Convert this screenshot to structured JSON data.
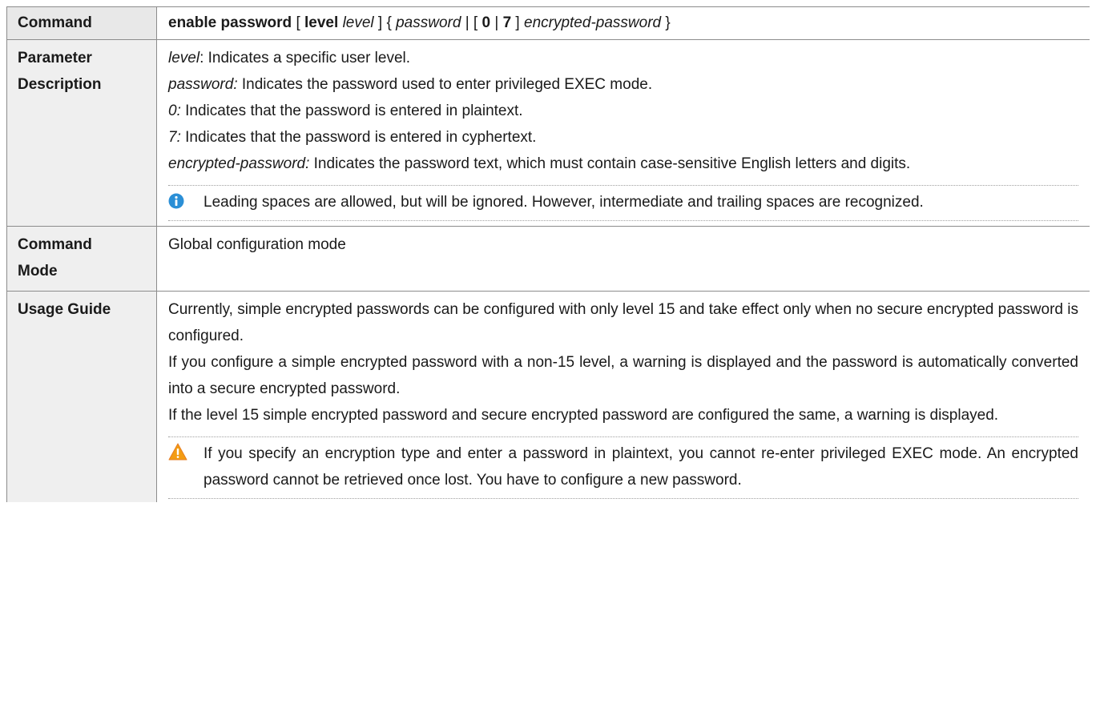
{
  "table": {
    "command": {
      "label": "Command",
      "syntax": {
        "kw1": "enable password",
        "s1": " [ ",
        "kw2": "level",
        "s2": " ",
        "arg1": "level",
        "s3": " ] { ",
        "arg2": "password",
        "s4": " | [ ",
        "kw3": "0",
        "s5": " | ",
        "kw4": "7",
        "s6": " ] ",
        "arg3": "encrypted-password",
        "s7": " }"
      }
    },
    "param": {
      "label_line1": "Parameter",
      "label_line2": "Description",
      "items": [
        {
          "term": "level",
          "sep": ":",
          "desc": " Indicates a specific user level."
        },
        {
          "term": "password:",
          "sep": "",
          "desc": " Indicates the password used to enter privileged EXEC mode."
        },
        {
          "term": "0:",
          "sep": "",
          "desc": " Indicates that the password is entered in plaintext."
        },
        {
          "term": "7:",
          "sep": "",
          "desc": " Indicates that the password is entered in cyphertext."
        },
        {
          "term": "encrypted-password:",
          "sep": "",
          "desc": " Indicates the password text, which must contain case-sensitive English letters and digits."
        }
      ],
      "note": "Leading spaces are allowed, but will be ignored. However, intermediate and trailing spaces are recognized."
    },
    "mode": {
      "label_line1": "Command",
      "label_line2": "Mode",
      "value": "Global configuration mode"
    },
    "usage": {
      "label": "Usage Guide",
      "paragraphs": [
        "Currently, simple encrypted passwords can be configured with only level 15 and take effect only when no secure encrypted password is configured.",
        "If you configure a simple encrypted password with a non-15 level, a warning is displayed and the password is automatically converted into a secure encrypted password.",
        "If the level 15 simple encrypted password and secure encrypted password are configured the same, a warning is displayed."
      ],
      "warning": "If you specify an encryption type and enter a password in plaintext, you cannot re-enter privileged EXEC mode. An encrypted password cannot be retrieved once lost. You have to configure a new password."
    }
  },
  "icons": {
    "note": "info-icon",
    "warning": "warning-icon"
  },
  "colors": {
    "info": "#2b8fd6",
    "warning": "#f39c12",
    "label_bg": "#efefef"
  }
}
